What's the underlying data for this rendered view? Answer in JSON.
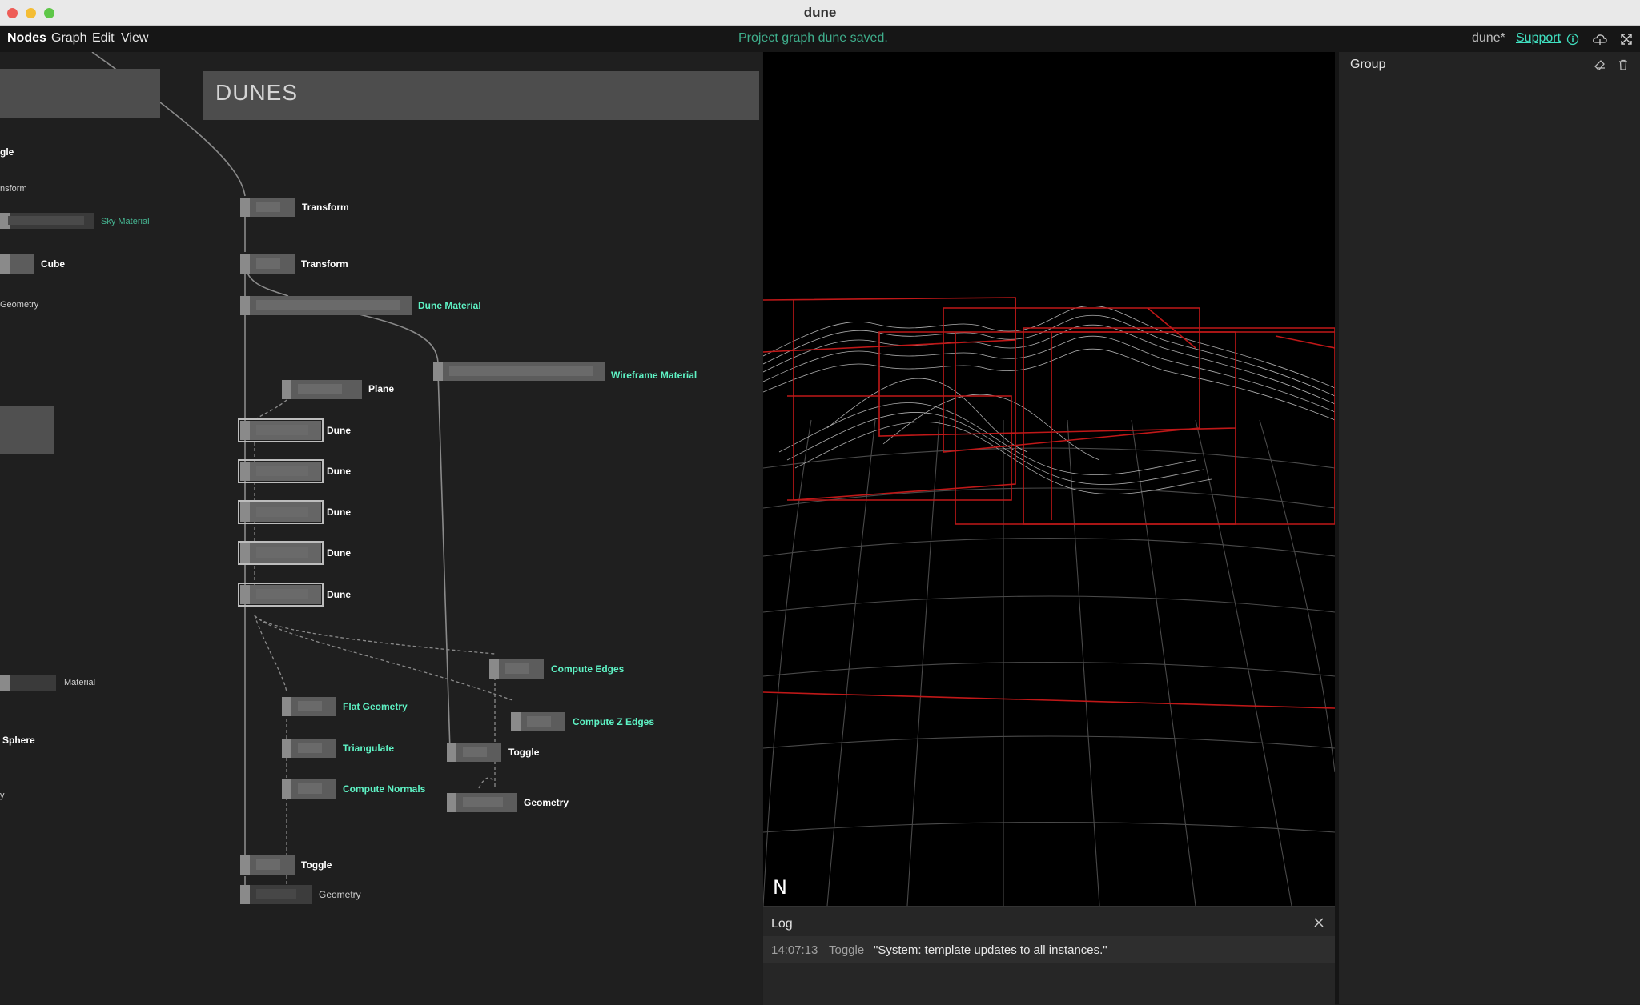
{
  "window": {
    "title": "dune"
  },
  "menu": {
    "items": [
      "Nodes",
      "Graph",
      "Edit",
      "View"
    ]
  },
  "status": {
    "message": "Project graph dune saved."
  },
  "header": {
    "project": "dune*",
    "support": "Support"
  },
  "graph": {
    "group_title": "DUNES",
    "left_labels": {
      "toggle_partial": "gle",
      "transform_partial": "nsform",
      "sky_material": "Sky Material",
      "cube": "Cube",
      "geometry_partial": "Geometry",
      "material": "Material",
      "sphere": "Sphere",
      "y_partial": "y"
    },
    "nodes": {
      "transform1": "Transform",
      "transform2": "Transform",
      "dune_material": "Dune Material",
      "wireframe_material": "Wireframe Material",
      "plane": "Plane",
      "dune1": "Dune",
      "dune2": "Dune",
      "dune3": "Dune",
      "dune4": "Dune",
      "dune5": "Dune",
      "compute_edges": "Compute Edges",
      "flat_geometry": "Flat Geometry",
      "compute_z_edges": "Compute Z Edges",
      "triangulate": "Triangulate",
      "toggle_right": "Toggle",
      "compute_normals": "Compute Normals",
      "geometry_right": "Geometry",
      "toggle_bottom": "Toggle",
      "geometry_bottom": "Geometry"
    }
  },
  "viewport": {
    "logo": "N"
  },
  "log": {
    "title": "Log",
    "entries": [
      {
        "time": "14:07:13",
        "node": "Toggle",
        "message": "\"System: template updates to all instances.\""
      }
    ]
  },
  "right_panel": {
    "title": "Group"
  },
  "colors": {
    "accent": "#40e0c0",
    "status": "#3fae8c",
    "wire_red": "#d02020"
  }
}
